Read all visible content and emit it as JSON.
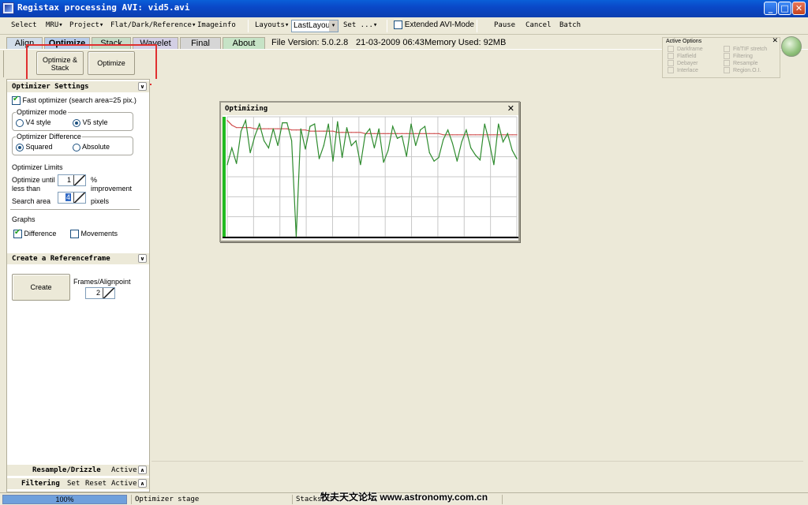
{
  "window": {
    "title": "Registax processing AVI: vid5.avi",
    "minimize": "_",
    "maximize": "□",
    "close": "✕"
  },
  "menubar": {
    "items": [
      "Select",
      "MRU▾",
      "Project▾",
      "Flat/Dark/Reference▾",
      "Imageinfo",
      "Layouts▾",
      "Set ...▾",
      "Pause",
      "Cancel",
      "Batch"
    ],
    "layout_value": "LastLayout",
    "layout_arrow": "▾",
    "extended_avi_label": "Extended AVI-Mode"
  },
  "tabs": {
    "items": [
      "Align",
      "Optimize",
      "Stack",
      "Wavelet",
      "Final",
      "About"
    ],
    "active": "Optimize",
    "file_version": "File Version: 5.0.2.8",
    "datetime": "21-03-2009 06:43",
    "memory": "Memory Used: 92MB",
    "colors": {
      "align": "#d2dde9",
      "optimize": "#b9cdea",
      "stack": "#c7dcc7",
      "wavelet": "#d3cfe4",
      "final": "#d6d6d6",
      "about": "#c6e3c6"
    }
  },
  "stage_buttons": {
    "optimize_stack_line1": "Optimize &",
    "optimize_stack_line2": "Stack",
    "optimize": "Optimize"
  },
  "active_options": {
    "header": "Active Options",
    "close": "✕",
    "left": [
      "Darkframe",
      "Flatfield",
      "Debayer",
      "Interlace"
    ],
    "right": [
      "Fit/TIF stretch",
      "Filtering",
      "Resample",
      "Region.O.I."
    ]
  },
  "optimizer_settings": {
    "header": "Optimizer Settings",
    "fast_optimizer": "Fast optimizer (search area=25 pix.)",
    "mode_caption": "Optimizer mode",
    "mode_v4": "V4 style",
    "mode_v5": "V5 style",
    "mode_selected": "V5 style",
    "diff_caption": "Optimizer Difference",
    "diff_squared": "Squared",
    "diff_absolute": "Absolute",
    "diff_selected": "Squared",
    "limits_label": "Optimizer Limits",
    "until_line1": "Optimize until",
    "until_line2": "less than",
    "until_value": "1",
    "until_unit_line1": "%",
    "until_unit_line2": "improvement",
    "search_area_label": "Search area",
    "search_area_value": "4",
    "search_area_unit": "pixels",
    "graphs_label": "Graphs",
    "graph_difference": "Difference",
    "graph_movements": "Movements"
  },
  "referenceframe": {
    "header": "Create a Referenceframe",
    "create_button": "Create",
    "frames_label": "Frames/Alignpoint",
    "frames_value": "2"
  },
  "bottom_sections": {
    "resample": {
      "label": "Resample/Drizzle",
      "status": "Active"
    },
    "filtering": {
      "label": "Filtering",
      "set": "Set",
      "reset": "Reset",
      "status": "Active"
    }
  },
  "optimizing_window": {
    "title": "Optimizing",
    "close": "✕"
  },
  "chart_data": {
    "type": "line",
    "title": "",
    "xlabel": "",
    "ylabel": "",
    "grid": true,
    "ylim": [
      0,
      100
    ],
    "x": [
      0,
      1,
      2,
      3,
      4,
      5,
      6,
      7,
      8,
      9,
      10,
      11,
      12,
      13,
      14,
      15,
      16,
      17,
      18,
      19,
      20,
      21,
      22,
      23,
      24,
      25,
      26,
      27,
      28,
      29,
      30,
      31,
      32,
      33,
      34,
      35,
      36,
      37,
      38,
      39,
      40,
      41,
      42,
      43,
      44,
      45,
      46,
      47,
      48,
      49,
      50,
      51,
      52,
      53,
      54,
      55,
      56,
      57,
      58,
      59,
      60,
      61,
      62,
      63
    ],
    "series": [
      {
        "color": "#2e8b2e",
        "values": [
          60,
          74,
          61,
          88,
          97,
          70,
          84,
          94,
          80,
          74,
          90,
          76,
          95,
          95,
          80,
          0,
          90,
          73,
          92,
          94,
          65,
          76,
          94,
          63,
          96,
          66,
          91,
          76,
          80,
          60,
          85,
          90,
          74,
          90,
          62,
          72,
          92,
          82,
          84,
          67,
          94,
          76,
          89,
          92,
          70,
          63,
          66,
          81,
          89,
          78,
          63,
          79,
          89,
          74,
          68,
          64,
          94,
          79,
          60,
          94,
          79,
          86,
          72,
          65
        ]
      },
      {
        "color": "#d05050",
        "values": [
          97,
          93,
          91,
          91,
          91,
          91,
          90,
          90,
          90,
          90,
          90,
          90,
          90,
          90,
          89,
          89,
          89,
          89,
          88,
          88,
          88,
          88,
          88,
          88,
          87,
          87,
          87,
          87,
          87,
          87,
          86,
          86,
          86,
          86,
          86,
          86,
          86,
          86,
          86,
          86,
          86,
          86,
          86,
          86,
          86,
          86,
          86,
          85,
          85,
          85,
          85,
          85,
          85,
          85,
          85,
          85,
          85,
          85,
          85,
          85,
          85,
          85,
          85,
          85
        ]
      }
    ],
    "progress_bar_color": "#22bb22"
  },
  "statusbar": {
    "progress_text": "100%",
    "progress_fraction": 1.0,
    "stage": "Optimizer stage",
    "stacksize": "Stacksize",
    "watermark": "牧夫天文论坛 www.astronomy.com.cn"
  }
}
